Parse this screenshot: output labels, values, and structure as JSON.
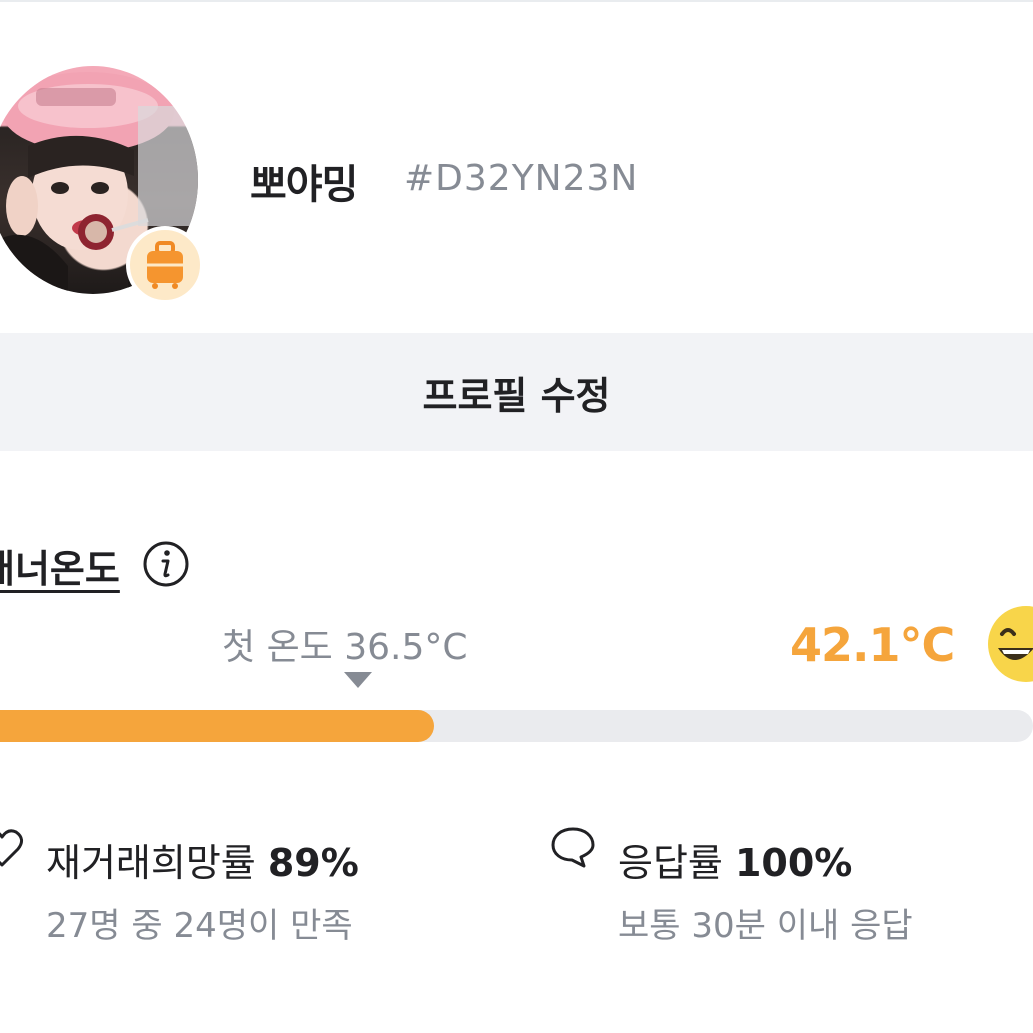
{
  "profile": {
    "nickname": "뽀야밍",
    "user_id": "#D32YN23N",
    "avatar_icon": "profile-photo",
    "badge_icon": "suitcase-icon"
  },
  "edit_button": {
    "label": "프로필 수정"
  },
  "manner_temp": {
    "title": "매너온도",
    "first_temp_label": "첫 온도 36.5°C",
    "current_temp_label": "42.1°C",
    "current_temp_value": 42.1,
    "bar_fill_percent": 42,
    "face_icon": "laughing-face-icon",
    "accent_color": "#f5a53c"
  },
  "stats": {
    "rebuy": {
      "label": "재거래희망률",
      "value": "89%",
      "sub": "27명 중 24명이 만족",
      "icon": "heart-icon"
    },
    "response": {
      "label": "응답률",
      "value": "100%",
      "sub": "보통 30분 이내 응답",
      "icon": "chat-bubble-icon"
    }
  }
}
